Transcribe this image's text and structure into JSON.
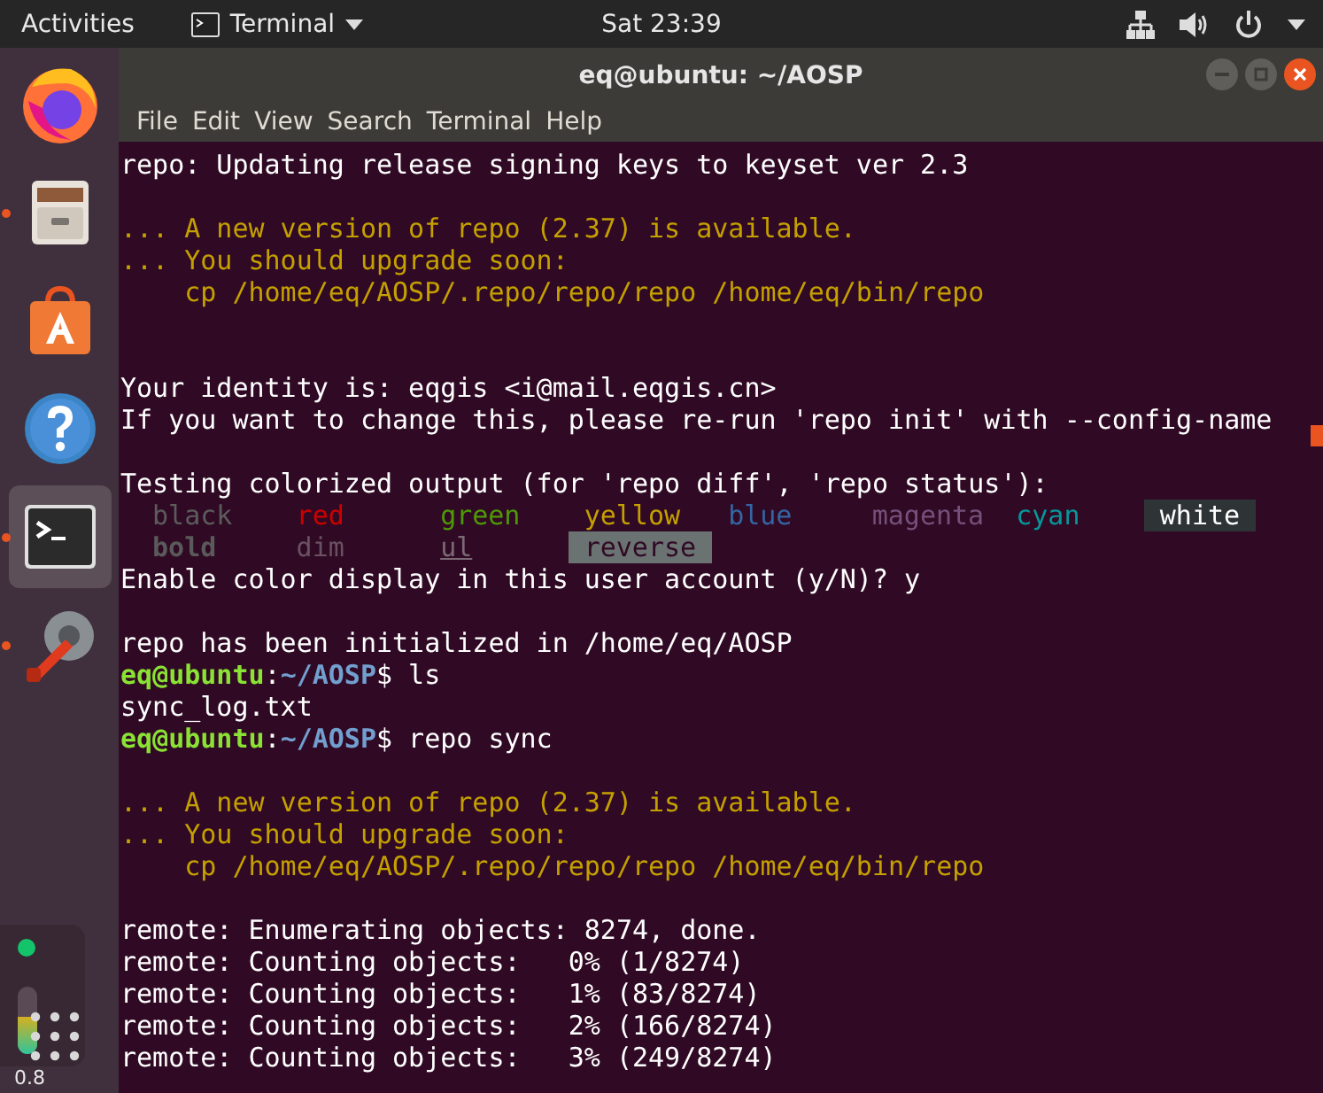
{
  "top_bar": {
    "activities": "Activities",
    "app_menu": "Terminal",
    "clock": "Sat 23:39"
  },
  "dock": {
    "items": [
      {
        "kind": "browser",
        "selected": false,
        "running": false
      },
      {
        "kind": "files",
        "selected": false,
        "running": true
      },
      {
        "kind": "software",
        "selected": false,
        "running": false
      },
      {
        "kind": "help",
        "selected": false,
        "running": false
      },
      {
        "kind": "terminal",
        "selected": true,
        "running": true
      },
      {
        "kind": "settings",
        "selected": false,
        "running": true
      }
    ],
    "widget": {
      "level": 0.55,
      "reading": "0.8"
    }
  },
  "window": {
    "title": "eq@ubuntu: ~/AOSP",
    "menu": [
      "File",
      "Edit",
      "View",
      "Search",
      "Terminal",
      "Help"
    ],
    "terminal": {
      "lines": [
        {
          "kind": "text",
          "segments": [
            {
              "text": "repo: Updating release signing keys to keyset ver 2.3",
              "color": "#ffffff"
            }
          ]
        },
        {
          "kind": "blank"
        },
        {
          "kind": "text",
          "segments": [
            {
              "text": "... A new version of repo (2.37) is available.",
              "color": "#c4a000"
            }
          ]
        },
        {
          "kind": "text",
          "segments": [
            {
              "text": "... You should upgrade soon:",
              "color": "#c4a000"
            }
          ]
        },
        {
          "kind": "text",
          "segments": [
            {
              "text": "    cp /home/eq/AOSP/.repo/repo/repo /home/eq/bin/repo",
              "color": "#c4a000"
            }
          ]
        },
        {
          "kind": "blank"
        },
        {
          "kind": "blank"
        },
        {
          "kind": "text",
          "segments": [
            {
              "text": "Your identity is: eqgis <i@mail.eqgis.cn>",
              "color": "#ffffff"
            }
          ]
        },
        {
          "kind": "text",
          "segments": [
            {
              "text": "If you want to change this, please re-run 'repo init' with --config-name",
              "color": "#ffffff"
            }
          ]
        },
        {
          "kind": "blank"
        },
        {
          "kind": "text",
          "segments": [
            {
              "text": "Testing colorized output (for 'repo diff', 'repo status'):",
              "color": "#ffffff"
            }
          ]
        },
        {
          "kind": "samples",
          "items": [
            {
              "text": "black",
              "color": "#5c5c5c",
              "kind": "plain"
            },
            {
              "text": "red",
              "color": "#cc0000",
              "kind": "plain"
            },
            {
              "text": "green",
              "color": "#4e9a06",
              "kind": "plain"
            },
            {
              "text": "yellow",
              "color": "#c4a000",
              "kind": "plain"
            },
            {
              "text": "blue",
              "color": "#3465a4",
              "kind": "plain"
            },
            {
              "text": "magenta",
              "color": "#75507b",
              "kind": "plain"
            },
            {
              "text": "cyan",
              "color": "#06989a",
              "kind": "plain"
            },
            {
              "text": "white",
              "color": "#2e3436",
              "kind": "highlight"
            }
          ]
        },
        {
          "kind": "samples",
          "items": [
            {
              "text": "bold",
              "color": "#5a5a5a",
              "kind": "bold"
            },
            {
              "text": "dim",
              "color": "#6a5262",
              "kind": "plain"
            },
            {
              "text": "ul",
              "color": "#7a6a74",
              "kind": "underline"
            },
            {
              "text": "reverse",
              "color": "#6a7272",
              "kind": "reverse"
            }
          ]
        },
        {
          "kind": "text",
          "segments": [
            {
              "text": "Enable color display in this user account (y/N)? y",
              "color": "#ffffff"
            }
          ]
        },
        {
          "kind": "blank"
        },
        {
          "kind": "text",
          "segments": [
            {
              "text": "repo has been initialized in /home/eq/AOSP",
              "color": "#ffffff"
            }
          ]
        },
        {
          "kind": "prompt",
          "user": "eq@ubuntu",
          "separator": ":",
          "path": "~/AOSP",
          "command": "$ ls"
        },
        {
          "kind": "text",
          "segments": [
            {
              "text": "sync_log.txt",
              "color": "#ffffff"
            }
          ]
        },
        {
          "kind": "prompt",
          "user": "eq@ubuntu",
          "separator": ":",
          "path": "~/AOSP",
          "command": "$ repo sync"
        },
        {
          "kind": "blank"
        },
        {
          "kind": "text",
          "segments": [
            {
              "text": "... A new version of repo (2.37) is available.",
              "color": "#c4a000"
            }
          ]
        },
        {
          "kind": "text",
          "segments": [
            {
              "text": "... You should upgrade soon:",
              "color": "#c4a000"
            }
          ]
        },
        {
          "kind": "text",
          "segments": [
            {
              "text": "    cp /home/eq/AOSP/.repo/repo/repo /home/eq/bin/repo",
              "color": "#c4a000"
            }
          ]
        },
        {
          "kind": "blank"
        },
        {
          "kind": "text",
          "segments": [
            {
              "text": "remote: Enumerating objects: 8274, done.",
              "color": "#ffffff"
            }
          ]
        },
        {
          "kind": "text",
          "segments": [
            {
              "text": "remote: Counting objects:   0% (1/8274)",
              "color": "#ffffff"
            }
          ]
        },
        {
          "kind": "text",
          "segments": [
            {
              "text": "remote: Counting objects:   1% (83/8274)",
              "color": "#ffffff"
            }
          ]
        },
        {
          "kind": "text",
          "segments": [
            {
              "text": "remote: Counting objects:   2% (166/8274)",
              "color": "#ffffff"
            }
          ]
        },
        {
          "kind": "text",
          "segments": [
            {
              "text": "remote: Counting objects:   3% (249/8274)",
              "color": "#ffffff"
            }
          ]
        }
      ]
    }
  }
}
